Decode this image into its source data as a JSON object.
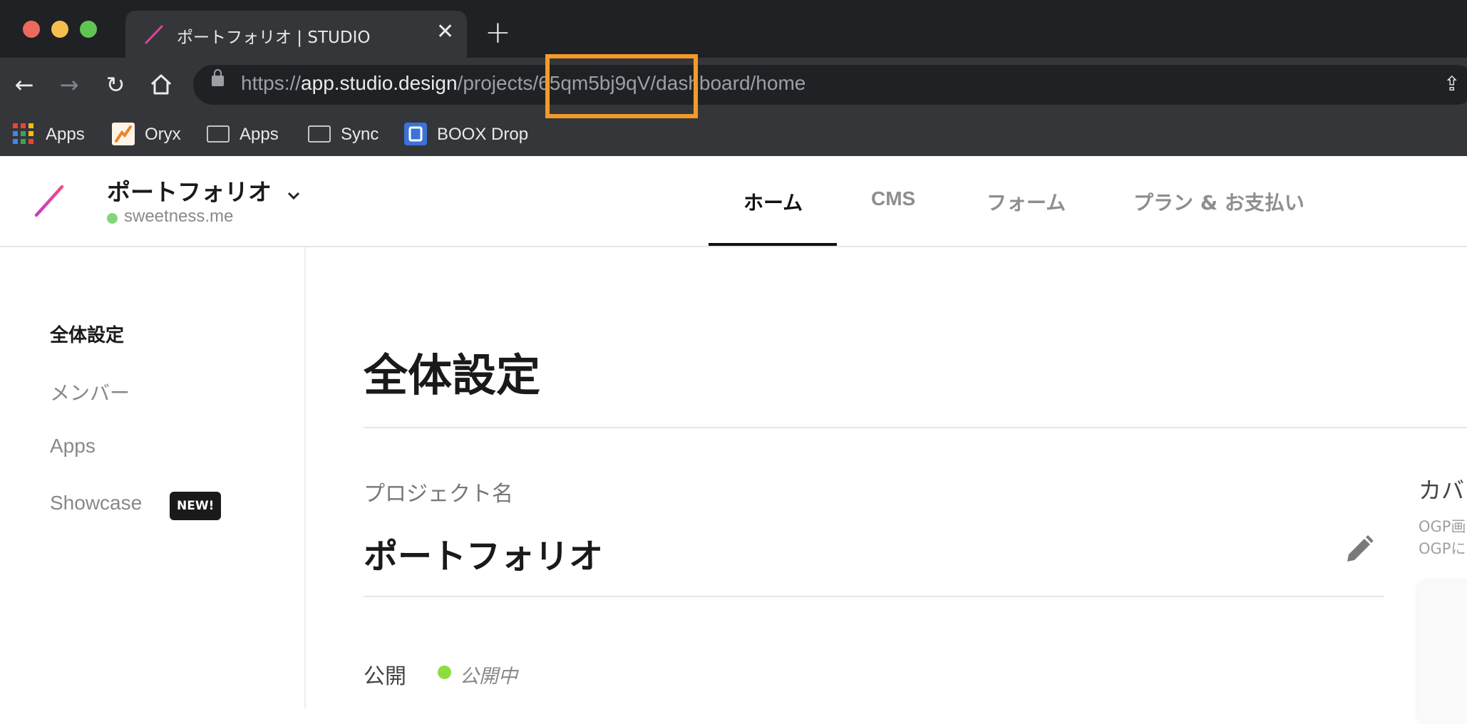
{
  "browser": {
    "tab_title": "ポートフォリオ | STUDIO",
    "url": {
      "scheme": "https://",
      "host": "app.studio.design",
      "path_before": "/projects/",
      "project_id": "65qm5bj9qV",
      "path_after": "/dashboard/home"
    },
    "bookmarks": [
      {
        "label": "Apps",
        "icon": "apps-grid-icon"
      },
      {
        "label": "Oryx",
        "icon": "oryx-icon"
      },
      {
        "label": "Apps",
        "icon": "folder-icon"
      },
      {
        "label": "Sync",
        "icon": "folder-icon"
      },
      {
        "label": "BOOX Drop",
        "icon": "boox-drop-icon"
      }
    ],
    "highlight_color": "#f39a2a"
  },
  "app": {
    "project_name": "ポートフォリオ",
    "domain": "sweetness.me",
    "nav": [
      {
        "label": "ホーム",
        "active": true
      },
      {
        "label": "CMS",
        "active": false
      },
      {
        "label": "フォーム",
        "active": false
      },
      {
        "label": "プラン & お支払い",
        "active": false
      }
    ]
  },
  "sidebar": {
    "items": [
      {
        "label": "全体設定",
        "active": true
      },
      {
        "label": "メンバー"
      },
      {
        "label": "Apps"
      },
      {
        "label": "Showcase",
        "badge": "NEW!"
      }
    ]
  },
  "main": {
    "page_title": "全体設定",
    "project_name_label": "プロジェクト名",
    "project_name_value": "ポートフォリオ",
    "publish_label": "公開",
    "publish_status": "公開中",
    "cover_label": "カバ",
    "ogp_line1": "OGP画",
    "ogp_line2": "OGPに"
  },
  "colors": {
    "accent_pink": "#e0449a",
    "status_green": "#8fdc3e",
    "domain_dot_green": "#7fd77a"
  }
}
